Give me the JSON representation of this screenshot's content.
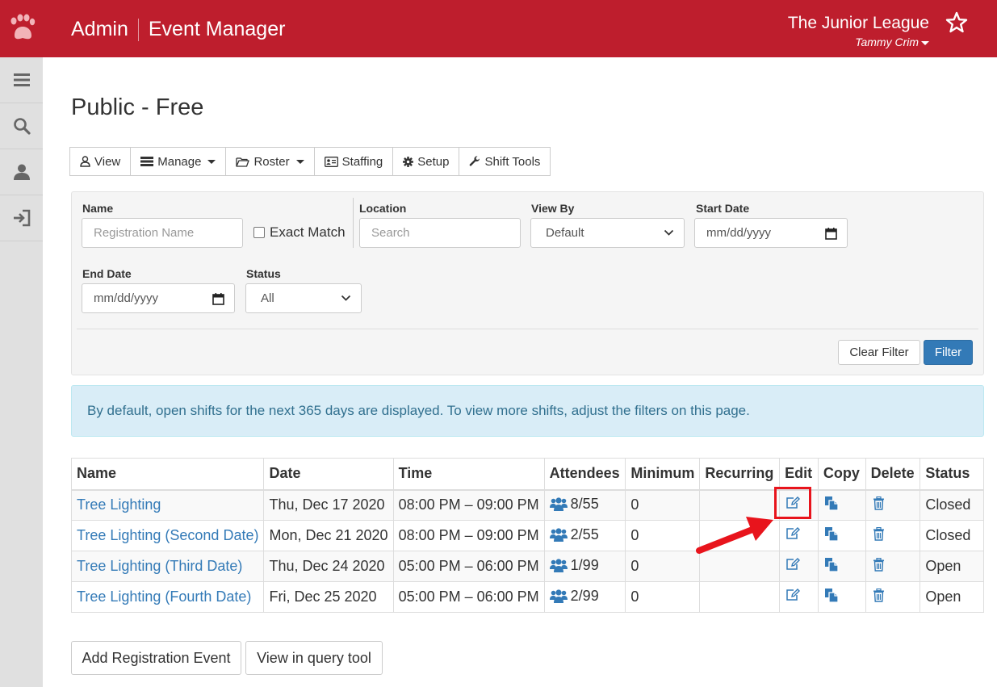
{
  "header": {
    "app_name": "Admin",
    "module_name": "Event Manager",
    "org_name": "The Junior League",
    "user_name": "Tammy Crim",
    "brand_color": "#be1e2d"
  },
  "sidebar": {
    "items": [
      {
        "icon": "menu-icon"
      },
      {
        "icon": "search-icon"
      },
      {
        "icon": "user-icon"
      },
      {
        "icon": "sign-in-icon"
      }
    ]
  },
  "page": {
    "title": "Public - Free"
  },
  "toolbar": {
    "view": "View",
    "manage": "Manage",
    "roster": "Roster",
    "staffing": "Staffing",
    "setup": "Setup",
    "shift_tools": "Shift Tools"
  },
  "filters": {
    "name_label": "Name",
    "name_placeholder": "Registration Name",
    "exact_match": "Exact Match",
    "location_label": "Location",
    "location_placeholder": "Search",
    "view_by_label": "View By",
    "view_by_value": "Default",
    "start_date_label": "Start Date",
    "start_date_placeholder": "mm/dd/yyyy",
    "end_date_label": "End Date",
    "end_date_placeholder": "mm/dd/yyyy",
    "status_label": "Status",
    "status_value": "All",
    "clear_label": "Clear Filter",
    "filter_label": "Filter"
  },
  "info_text": "By default, open shifts for the next 365 days are displayed. To view more shifts, adjust the filters on this page.",
  "table": {
    "headers": [
      "Name",
      "Date",
      "Time",
      "Attendees",
      "Minimum",
      "Recurring",
      "Edit",
      "Copy",
      "Delete",
      "Status"
    ],
    "rows": [
      {
        "name": "Tree Lighting",
        "date": "Thu, Dec 17 2020",
        "time": "08:00 PM – 09:00 PM",
        "attendees": "8/55",
        "minimum": "0",
        "recurring": "",
        "status": "Closed"
      },
      {
        "name": "Tree Lighting (Second Date)",
        "date": "Mon, Dec 21 2020",
        "time": "08:00 PM – 09:00 PM",
        "attendees": "2/55",
        "minimum": "0",
        "recurring": "",
        "status": "Closed"
      },
      {
        "name": "Tree Lighting (Third Date)",
        "date": "Thu, Dec 24 2020",
        "time": "05:00 PM – 06:00 PM",
        "attendees": "1/99",
        "minimum": "0",
        "recurring": "",
        "status": "Open"
      },
      {
        "name": "Tree Lighting (Fourth Date)",
        "date": "Fri, Dec 25 2020",
        "time": "05:00 PM – 06:00 PM",
        "attendees": "2/99",
        "minimum": "0",
        "recurring": "",
        "status": "Open"
      }
    ]
  },
  "actions": {
    "add_registration": "Add Registration Event",
    "view_query": "View in query tool"
  },
  "colors": {
    "link": "#337ab7",
    "primary_button": "#337ab7",
    "annotation": "#e8141c"
  }
}
